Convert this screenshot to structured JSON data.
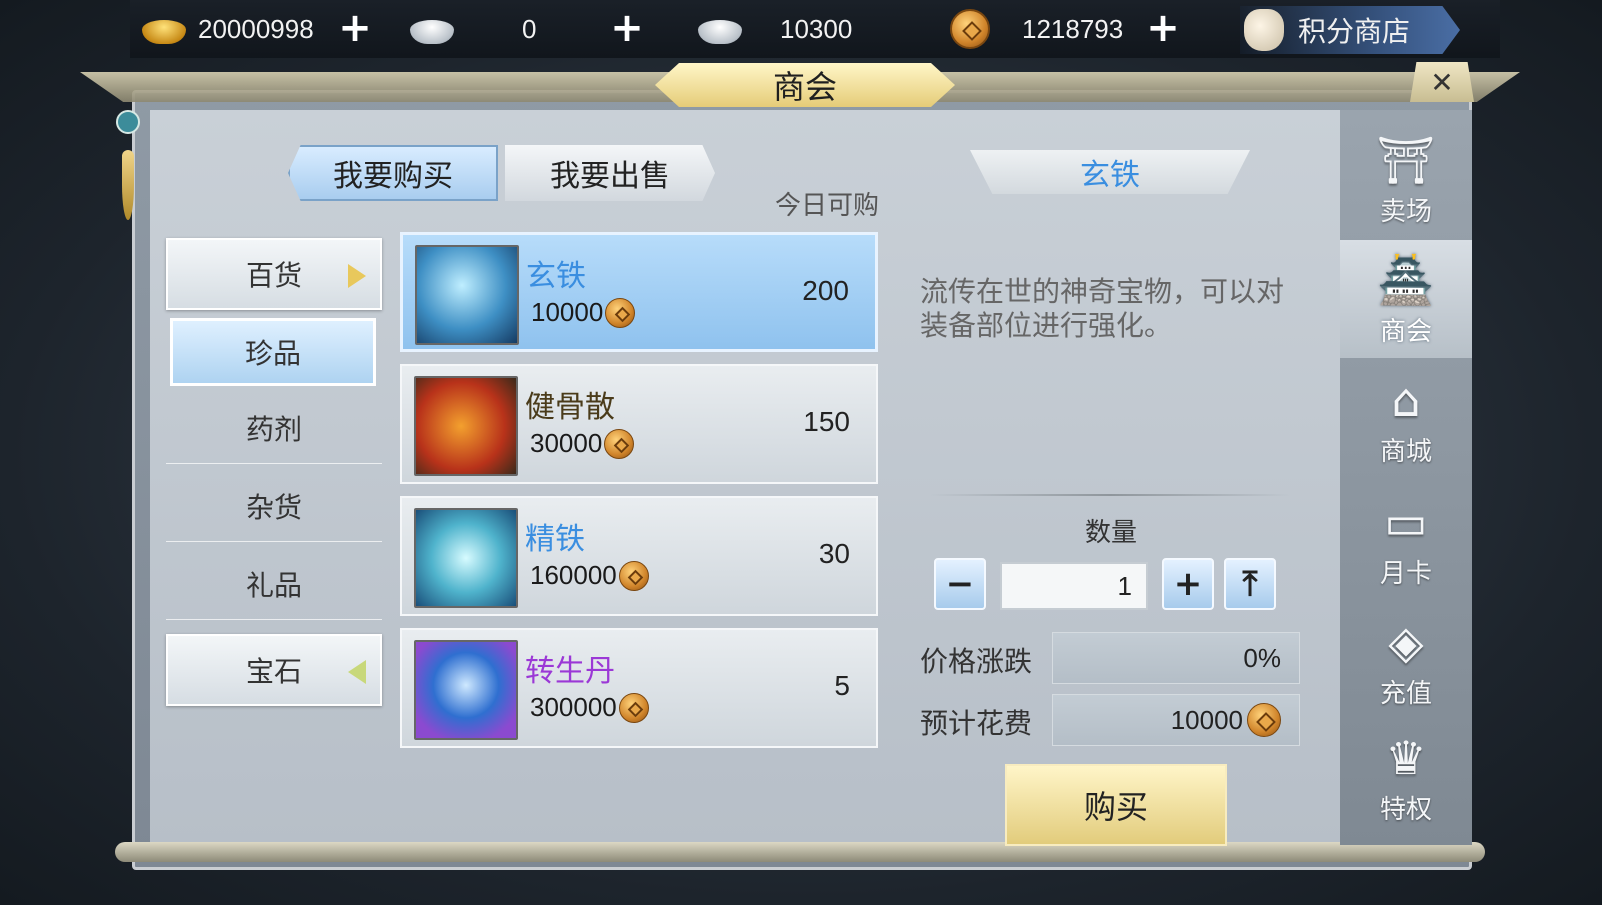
{
  "currencies": [
    {
      "icon": "gold-ingot-icon",
      "value": "20000998"
    },
    {
      "icon": "silver-ingot-icon",
      "value": "0"
    },
    {
      "icon": "bound-silver-ingot-icon",
      "value": "10300"
    },
    {
      "icon": "copper-coin-icon",
      "value": "1218793"
    }
  ],
  "points_shop_label": "积分商店",
  "title": "商会",
  "tabs": {
    "buy": "我要购买",
    "sell": "我要出售"
  },
  "today_label": "今日可购",
  "categories": [
    {
      "label": "百货",
      "type": "main"
    },
    {
      "label": "珍品",
      "type": "active"
    },
    {
      "label": "药剂",
      "type": "sub"
    },
    {
      "label": "杂货",
      "type": "sub"
    },
    {
      "label": "礼品",
      "type": "sub"
    },
    {
      "label": "宝石",
      "type": "main"
    }
  ],
  "items": [
    {
      "name": "玄铁",
      "price": "10000",
      "qty": "200",
      "name_color": "#3a8ee0",
      "icon": "mystic-iron-icon"
    },
    {
      "name": "健骨散",
      "price": "30000",
      "qty": "150",
      "name_color": "#4a3b1a",
      "icon": "pouch-icon"
    },
    {
      "name": "精铁",
      "price": "160000",
      "qty": "30",
      "name_color": "#3a8ee0",
      "icon": "refined-iron-icon"
    },
    {
      "name": "转生丹",
      "price": "300000",
      "qty": "5",
      "name_color": "#9b38d6",
      "icon": "rebirth-pill-icon"
    }
  ],
  "detail": {
    "title": "玄铁",
    "description": "流传在世的神奇宝物，可以对装备部位进行强化。",
    "qty_label": "数量",
    "qty_value": "1",
    "minus_label": "−",
    "plus_label": "+",
    "max_label": "⤒",
    "price_change_label": "价格涨跌",
    "price_change_value": "0%",
    "cost_label": "预计花费",
    "cost_value": "10000",
    "buy_label": "购买"
  },
  "sidebar": [
    {
      "label": "卖场",
      "icon": "market-icon",
      "active": false
    },
    {
      "label": "商会",
      "icon": "guild-hall-icon",
      "active": true
    },
    {
      "label": "商城",
      "icon": "shop-stall-icon",
      "active": false
    },
    {
      "label": "月卡",
      "icon": "month-card-icon",
      "active": false
    },
    {
      "label": "充值",
      "icon": "recharge-icon",
      "active": false
    },
    {
      "label": "特权",
      "icon": "privilege-icon",
      "active": false
    }
  ],
  "colors": {
    "accent_blue": "#3a8ee0",
    "buy_gold": "#e2cc7c",
    "purple_item": "#9b38d6"
  }
}
